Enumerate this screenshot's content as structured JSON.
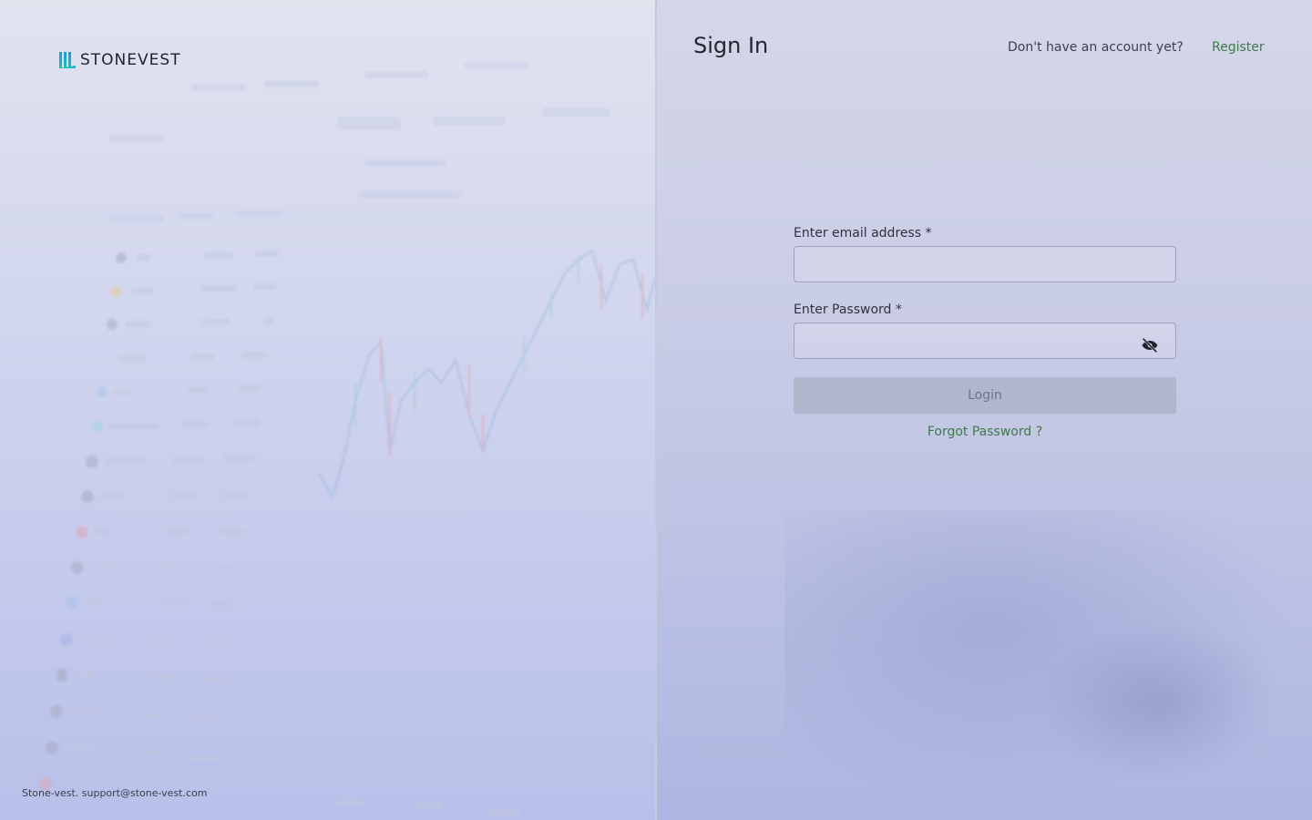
{
  "brand": {
    "name": "STONEVEST",
    "colors": {
      "mark_top": "#1a9be0",
      "mark_bottom": "#1fc3a6"
    }
  },
  "footer": {
    "text": "Stone-vest. support@stone-vest.com"
  },
  "header": {
    "title": "Sign In",
    "no_account_text": "Don't have an account yet?",
    "register_label": "Register"
  },
  "form": {
    "email_label": "Enter email address *",
    "email_value": "",
    "password_label": "Enter Password *",
    "password_value": "",
    "login_label": "Login",
    "forgot_label": "Forgot Password ?"
  },
  "icons": {
    "password_toggle": "eye-off-icon"
  },
  "colors": {
    "link": "#3f7a4d",
    "login_button_bg": "#b2b6cc"
  }
}
